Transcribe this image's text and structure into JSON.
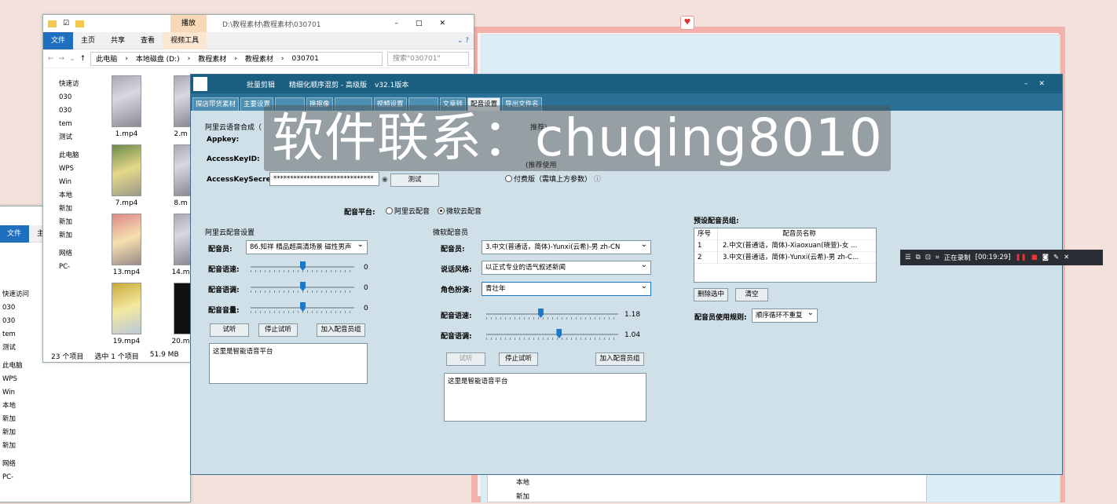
{
  "explorer_back": {
    "ribbon_tabs": [
      "文件",
      "主页"
    ],
    "nav_items": [
      "快速访问",
      "030",
      "030",
      "tem",
      "测试",
      "此电脑",
      "WPS",
      "Win",
      "本地",
      "新加",
      "新加",
      "新加",
      "网络",
      "PC-"
    ]
  },
  "explorer": {
    "title_tab": "播放",
    "title_path": "D:\\教程素材\\教程素材\\030701",
    "ribbon_tabs": [
      "文件",
      "主页",
      "共享",
      "查看",
      "视频工具"
    ],
    "breadcrumb": [
      "此电脑",
      "本地磁盘 (D:)",
      "教程素材",
      "教程素材",
      "030701"
    ],
    "search_placeholder": "搜索\"030701\"",
    "nav_items": [
      "快速访",
      "030",
      "030",
      "tem",
      "测试",
      "此电脑",
      "WPS",
      "Win",
      "本地",
      "新加",
      "新加",
      "新加",
      "网络",
      "PC-"
    ],
    "files": [
      "1.mp4",
      "2.m",
      "7.mp4",
      "8.m",
      "13.mp4",
      "14.m",
      "19.mp4",
      "20.m"
    ],
    "status_count": "23 个项目",
    "status_selected": "选中 1 个项目",
    "status_size": "51.9 MB"
  },
  "app": {
    "title_a": "批量剪辑",
    "title_b": "精细化顺序混剪 - 高级版",
    "version": "v32.1版本",
    "tabs": [
      "探店带货素材",
      "主要设置",
      "",
      "换抠像",
      "",
      "视频设置",
      "",
      "文章转",
      "配音设置",
      "导出文件名"
    ],
    "aliyun_synth_label": "阿里云语音合成（",
    "appkey_label": "Appkey:",
    "accesskeyid_label": "AccessKeyID:",
    "accesskeysecret_label": "AccessKeySecret:",
    "secret_value": "******************************",
    "test_button": "测试",
    "recommend_text": "推荐)",
    "recommend_use": "(推荐使用",
    "paid_option": "付费版（需填上方参数）",
    "platform_label": "配音平台:",
    "platform_aliyun": "阿里云配音",
    "platform_ms": "微软云配音",
    "aliyun_section": "阿里云配音设置",
    "ms_section": "微软配音员",
    "voice_label": "配音员:",
    "aliyun_voice": "86.知祥 精品超高清场景 磁性男声",
    "speed_label": "配音语速:",
    "pitch_label": "配音语调:",
    "volume_label": "配音音量:",
    "aliyun_speed": "0",
    "aliyun_pitch": "0",
    "aliyun_volume": "0",
    "try_button": "试听",
    "stop_button": "停止试听",
    "add_group_button": "加入配音员组",
    "sample_text": "这里是智能语音平台",
    "ms_voice": "3.中文(普通话，简体)-Yunxi(云希)-男 zh-CN",
    "style_label": "说话风格:",
    "ms_style": "以正式专业的语气叙述新闻",
    "role_label": "角色扮演:",
    "ms_role": "青壮年",
    "ms_speed": "1.18",
    "ms_pitch": "1.04",
    "group_title": "预设配音员组:",
    "group_col_index": "序号",
    "group_col_name": "配音员名称",
    "group_rows": [
      {
        "idx": "1",
        "name": "2.中文(普通话，简体)-Xiaoxuan(晓萱)-女 ..."
      },
      {
        "idx": "2",
        "name": "3.中文(普通话，简体)-Yunxi(云希)-男 zh-C..."
      }
    ],
    "delete_selected": "删除选中",
    "clear_button": "清空",
    "rule_label": "配音员使用规则:",
    "rule_value": "顺序循环不重复"
  },
  "slider_levels": {
    "aliyun_speed": 0.5,
    "aliyun_pitch": 0.5,
    "aliyun_volume": 0.5,
    "ms_speed": 0.41,
    "ms_pitch": 0.55
  },
  "watermark": "软件联系：chuqing8010",
  "recorder": {
    "status": "正在录制",
    "time": "[00:19:29]"
  },
  "bg_list": [
    "本地",
    "新加"
  ]
}
